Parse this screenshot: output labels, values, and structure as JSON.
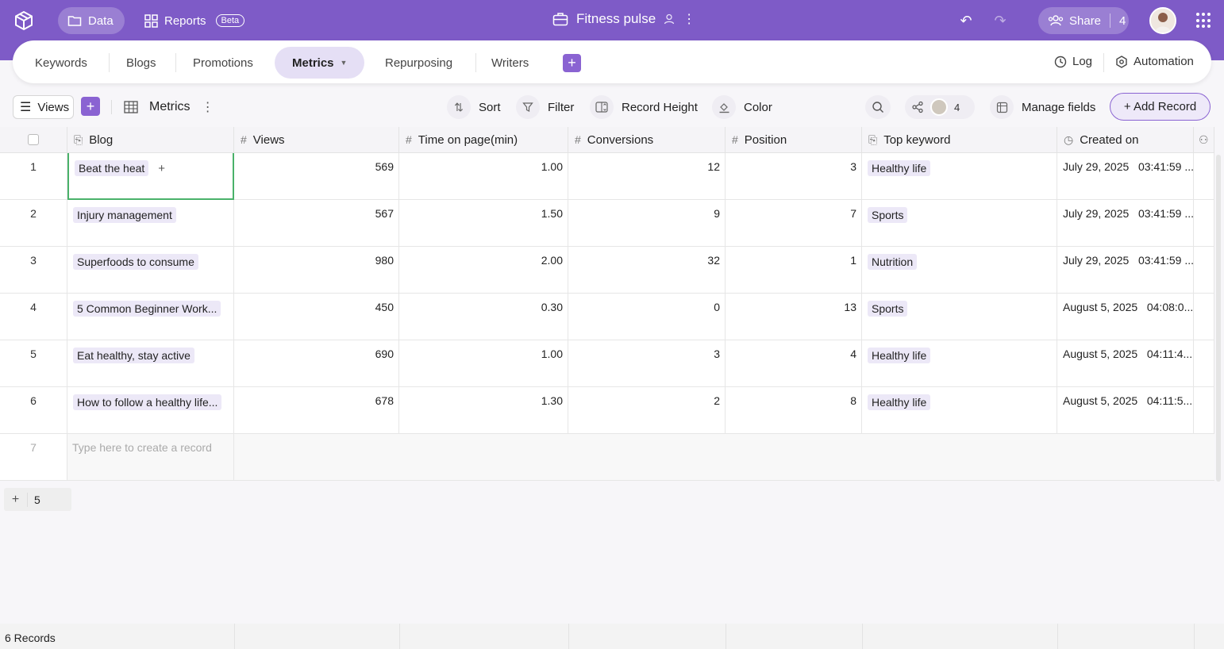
{
  "topbar": {
    "data_label": "Data",
    "reports_label": "Reports",
    "beta_label": "Beta",
    "app_name": "Fitness pulse",
    "share_label": "Share",
    "share_count": "4"
  },
  "tabs": [
    "Keywords",
    "Blogs",
    "Promotions",
    "Metrics",
    "Repurposing",
    "Writers"
  ],
  "tab_actions": {
    "log": "Log",
    "automation": "Automation"
  },
  "toolbar": {
    "views": "Views",
    "view_name": "Metrics",
    "sort": "Sort",
    "filter": "Filter",
    "record_height": "Record Height",
    "color": "Color",
    "collaborators": "4",
    "manage_fields": "Manage fields",
    "add_record": "+ Add Record"
  },
  "columns": {
    "blog": "Blog",
    "views": "Views",
    "time": "Time on page(min)",
    "conversions": "Conversions",
    "position": "Position",
    "keyword": "Top keyword",
    "created": "Created on"
  },
  "rows": [
    {
      "idx": "1",
      "blog": "Beat the heat",
      "views": "569",
      "time": "1.00",
      "conv": "12",
      "pos": "3",
      "kw": "Healthy life",
      "created": "July 29, 2025   03:41:59 ..."
    },
    {
      "idx": "2",
      "blog": "Injury management",
      "views": "567",
      "time": "1.50",
      "conv": "9",
      "pos": "7",
      "kw": "Sports",
      "created": "July 29, 2025   03:41:59 ..."
    },
    {
      "idx": "3",
      "blog": "Superfoods to consume",
      "views": "980",
      "time": "2.00",
      "conv": "32",
      "pos": "1",
      "kw": "Nutrition",
      "created": "July 29, 2025   03:41:59 ..."
    },
    {
      "idx": "4",
      "blog": "5 Common Beginner Work...",
      "views": "450",
      "time": "0.30",
      "conv": "0",
      "pos": "13",
      "kw": "Sports",
      "created": "August 5, 2025   04:08:0..."
    },
    {
      "idx": "5",
      "blog": "Eat healthy, stay active",
      "views": "690",
      "time": "1.00",
      "conv": "3",
      "pos": "4",
      "kw": "Healthy life",
      "created": "August 5, 2025   04:11:4..."
    },
    {
      "idx": "6",
      "blog": "How to follow a healthy life...",
      "views": "678",
      "time": "1.30",
      "conv": "2",
      "pos": "8",
      "kw": "Healthy life",
      "created": "August 5, 2025   04:11:5..."
    }
  ],
  "new_row": {
    "idx": "7",
    "placeholder": "Type here to create a record"
  },
  "group_count": "5",
  "footer": {
    "records": "6 Records"
  },
  "colors": {
    "brand": "#7e5bc7",
    "accent": "#8a63d2",
    "chip": "#ece8f7"
  }
}
